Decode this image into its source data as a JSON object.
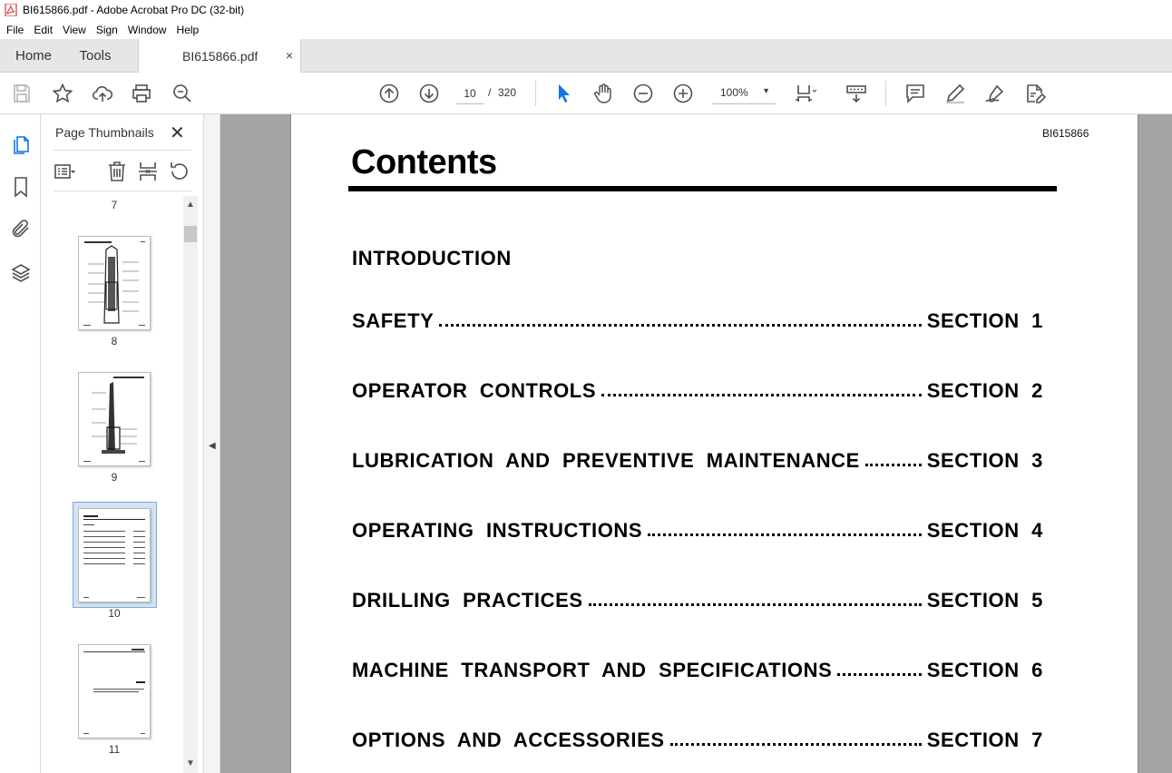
{
  "window": {
    "title": "BI615866.pdf - Adobe Acrobat Pro DC (32-bit)"
  },
  "menu": [
    "File",
    "Edit",
    "View",
    "Sign",
    "Window",
    "Help"
  ],
  "tabs": {
    "home": "Home",
    "tools": "Tools",
    "document": "BI615866.pdf",
    "close": "×"
  },
  "toolbar": {
    "current_page": "10",
    "page_separator": "/",
    "total_pages": "320",
    "zoom": "100%",
    "icons": [
      "save-icon",
      "star-icon",
      "upload-icon",
      "print-icon",
      "search-zoom-icon",
      "page-up-icon",
      "page-down-icon",
      "select-arrow-icon",
      "hand-icon",
      "zoom-out-icon",
      "zoom-in-icon",
      "page-fit-icon",
      "scroll-mode-icon",
      "comment-icon",
      "highlight-icon",
      "sign-icon",
      "edit-pdf-icon"
    ]
  },
  "left_rail": {
    "icons": [
      "page-thumbnails-icon",
      "bookmark-icon",
      "attachment-icon",
      "layers-icon"
    ]
  },
  "thumb_panel": {
    "title": "Page Thumbnails",
    "close": "✕",
    "page_numbers": [
      "7",
      "8",
      "9",
      "10",
      "11"
    ],
    "selected_page": "10"
  },
  "document": {
    "doc_id": "BI615866",
    "heading": "Contents",
    "toc": [
      {
        "title": "INTRODUCTION",
        "section": ""
      },
      {
        "title": "SAFETY",
        "section": "SECTION  1"
      },
      {
        "title": "OPERATOR  CONTROLS",
        "section": "SECTION  2"
      },
      {
        "title": "LUBRICATION  AND  PREVENTIVE  MAINTENANCE",
        "section": "SECTION  3"
      },
      {
        "title": "OPERATING  INSTRUCTIONS",
        "section": "SECTION  4"
      },
      {
        "title": "DRILLING  PRACTICES",
        "section": "SECTION  5"
      },
      {
        "title": "MACHINE  TRANSPORT  AND  SPECIFICATIONS",
        "section": "SECTION  6"
      },
      {
        "title": "OPTIONS  AND  ACCESSORIES",
        "section": "SECTION  7"
      }
    ]
  },
  "colors": {
    "accent_blue": "#1473e6",
    "pdf_red": "#d7373f",
    "doc_bg": "#a4a4a4"
  }
}
